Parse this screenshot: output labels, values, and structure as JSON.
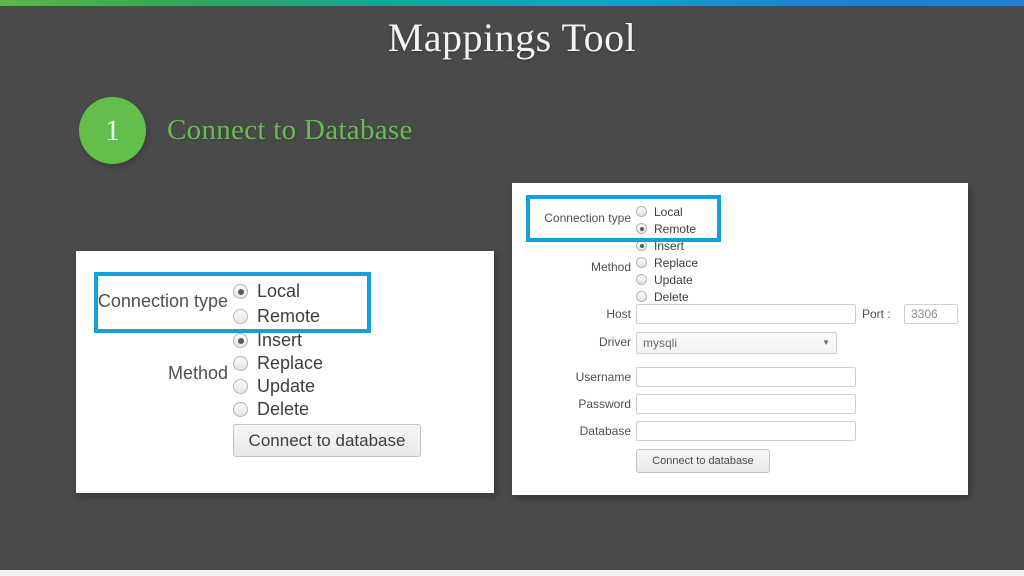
{
  "slide": {
    "title": "Mappings Tool",
    "title_dots": ".....",
    "accent_start_color": "#5cb84a",
    "accent_end_color": "#1f7fd1",
    "background_color": "#4a4a4a"
  },
  "step": {
    "number": "1",
    "title": "Connect to Database",
    "badge_color": "#63bf4b",
    "title_color": "#63bf4b"
  },
  "highlight": {
    "color": "#159fdd"
  },
  "local_panel": {
    "connection_type_label": "Connection type",
    "connection_options": [
      {
        "label": "Local",
        "selected": true
      },
      {
        "label": "Remote",
        "selected": false
      }
    ],
    "method_label": "Method",
    "method_options": [
      {
        "label": "Insert",
        "selected": true
      },
      {
        "label": "Replace",
        "selected": false
      },
      {
        "label": "Update",
        "selected": false
      },
      {
        "label": "Delete",
        "selected": false
      }
    ],
    "connect_button_label": "Connect to database"
  },
  "remote_panel": {
    "connection_type_label": "Connection type",
    "connection_options": [
      {
        "label": "Local",
        "selected": false
      },
      {
        "label": "Remote",
        "selected": true
      }
    ],
    "method_label": "Method",
    "method_options": [
      {
        "label": "Insert",
        "selected": true
      },
      {
        "label": "Replace",
        "selected": false
      },
      {
        "label": "Update",
        "selected": false
      },
      {
        "label": "Delete",
        "selected": false
      }
    ],
    "host_label": "Host",
    "host_value": "",
    "port_label": "Port :",
    "port_value": "3306",
    "driver_label": "Driver",
    "driver_value": "mysqli",
    "driver_caret": "▼",
    "username_label": "Username",
    "username_value": "",
    "password_label": "Password",
    "password_value": "",
    "database_label": "Database",
    "database_value": "",
    "connect_button_label": "Connect to database"
  }
}
